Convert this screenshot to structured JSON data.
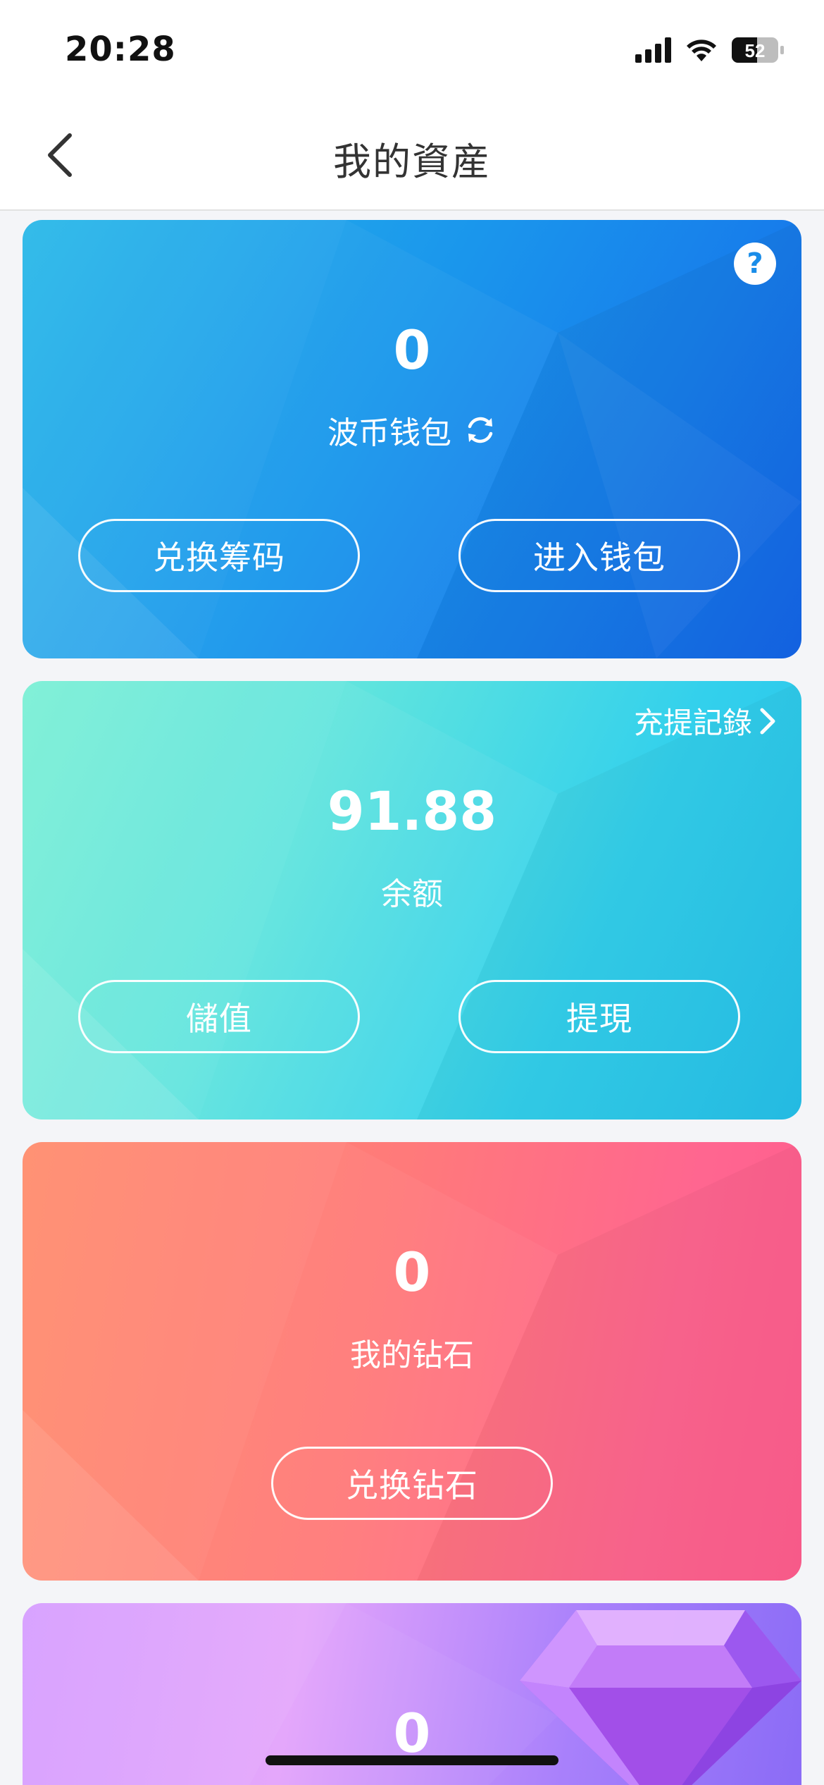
{
  "status_bar": {
    "time": "20:28",
    "battery_level": "52"
  },
  "nav": {
    "title": "我的資産",
    "back_icon": "chevron-left-icon"
  },
  "wallet_card": {
    "value": "0",
    "label": "波币钱包",
    "refresh_icon": "refresh-icon",
    "help_icon": "question-icon",
    "help_glyph": "?",
    "buttons": {
      "exchange": "兑换筹码",
      "enter": "进入钱包"
    },
    "gradient": [
      "#28b8e8",
      "#1466ea"
    ]
  },
  "balance_card": {
    "value": "91.88",
    "label": "余额",
    "records_link": "充提記錄",
    "buttons": {
      "deposit": "儲值",
      "withdraw": "提現"
    },
    "gradient": [
      "#78efd4",
      "#26c1ea"
    ]
  },
  "diamond_card": {
    "value": "0",
    "label": "我的钻石",
    "buttons": {
      "exchange": "兑换钻石"
    },
    "gradient": [
      "#ff8a6a",
      "#ff5d8e"
    ]
  },
  "purple_card": {
    "value": "0",
    "icon": "diamond-gem-icon",
    "gradient": [
      "#d59cff",
      "#8a6bf6"
    ]
  }
}
